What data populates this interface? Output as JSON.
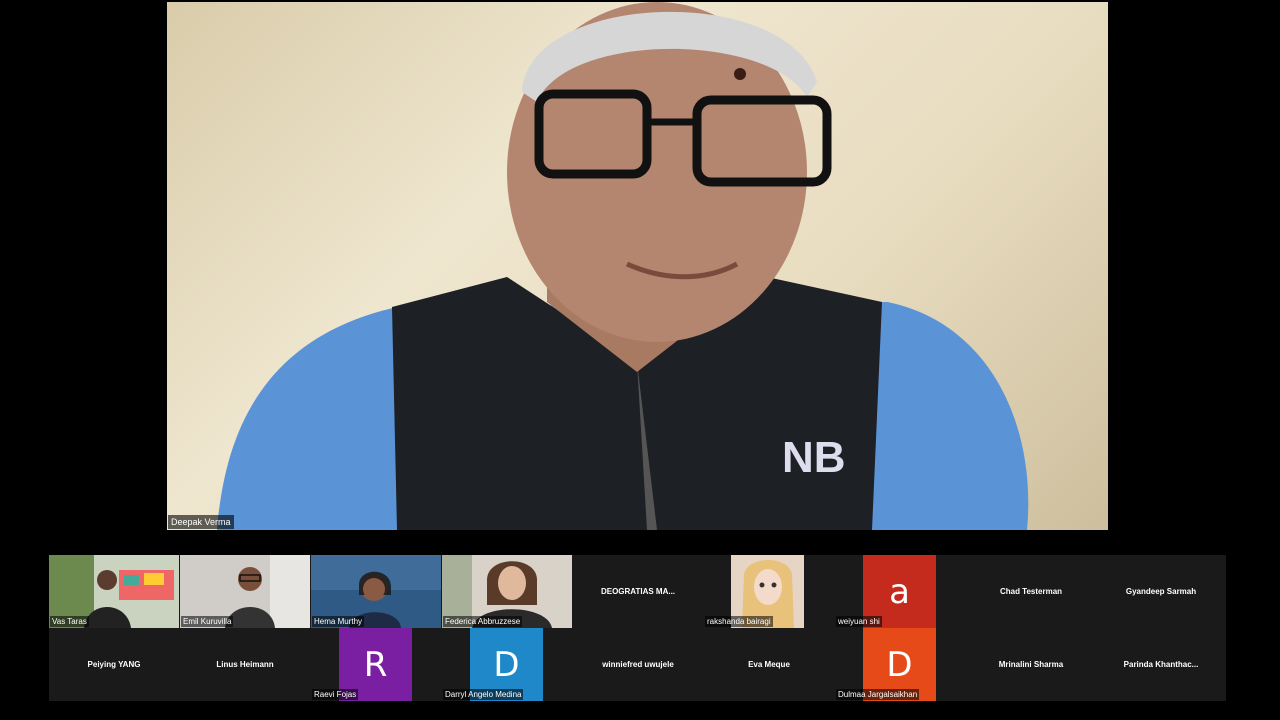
{
  "speaker": {
    "name": "Deepak Verma"
  },
  "gallery": {
    "row1": [
      {
        "name": "Vas Taras",
        "kind": "video"
      },
      {
        "name": "Emil Kuruvilla",
        "kind": "video"
      },
      {
        "name": "Hema Murthy",
        "kind": "video"
      },
      {
        "name": "Federica Abbruzzese",
        "kind": "video"
      },
      {
        "name": "DEOGRATIAS   MA...",
        "kind": "name"
      },
      {
        "name": "rakshanda bairagi",
        "kind": "photo"
      },
      {
        "name": "weiyuan shi",
        "kind": "avatar",
        "letter": "a",
        "color": "#c42b1c"
      },
      {
        "name": "Chad Testerman",
        "kind": "name"
      },
      {
        "name": "Gyandeep Sarmah",
        "kind": "name"
      }
    ],
    "row2": [
      {
        "name": "Peiying YANG",
        "kind": "name"
      },
      {
        "name": "Linus Heimann",
        "kind": "name"
      },
      {
        "name": "Raevi Fojas",
        "kind": "avatar",
        "letter": "R",
        "color": "#7b1fa2"
      },
      {
        "name": "Darryl Angelo Medina",
        "kind": "avatar",
        "letter": "D",
        "color": "#1e88c9"
      },
      {
        "name": "winniefred uwujele",
        "kind": "name"
      },
      {
        "name": "Eva Meque",
        "kind": "name"
      },
      {
        "name": "Dulmaa Jargalsaikhan",
        "kind": "avatar",
        "letter": "D",
        "color": "#e64a19"
      },
      {
        "name": "Mrinalini Sharma",
        "kind": "name"
      },
      {
        "name": "Parinda  Khanthac...",
        "kind": "name"
      }
    ]
  }
}
